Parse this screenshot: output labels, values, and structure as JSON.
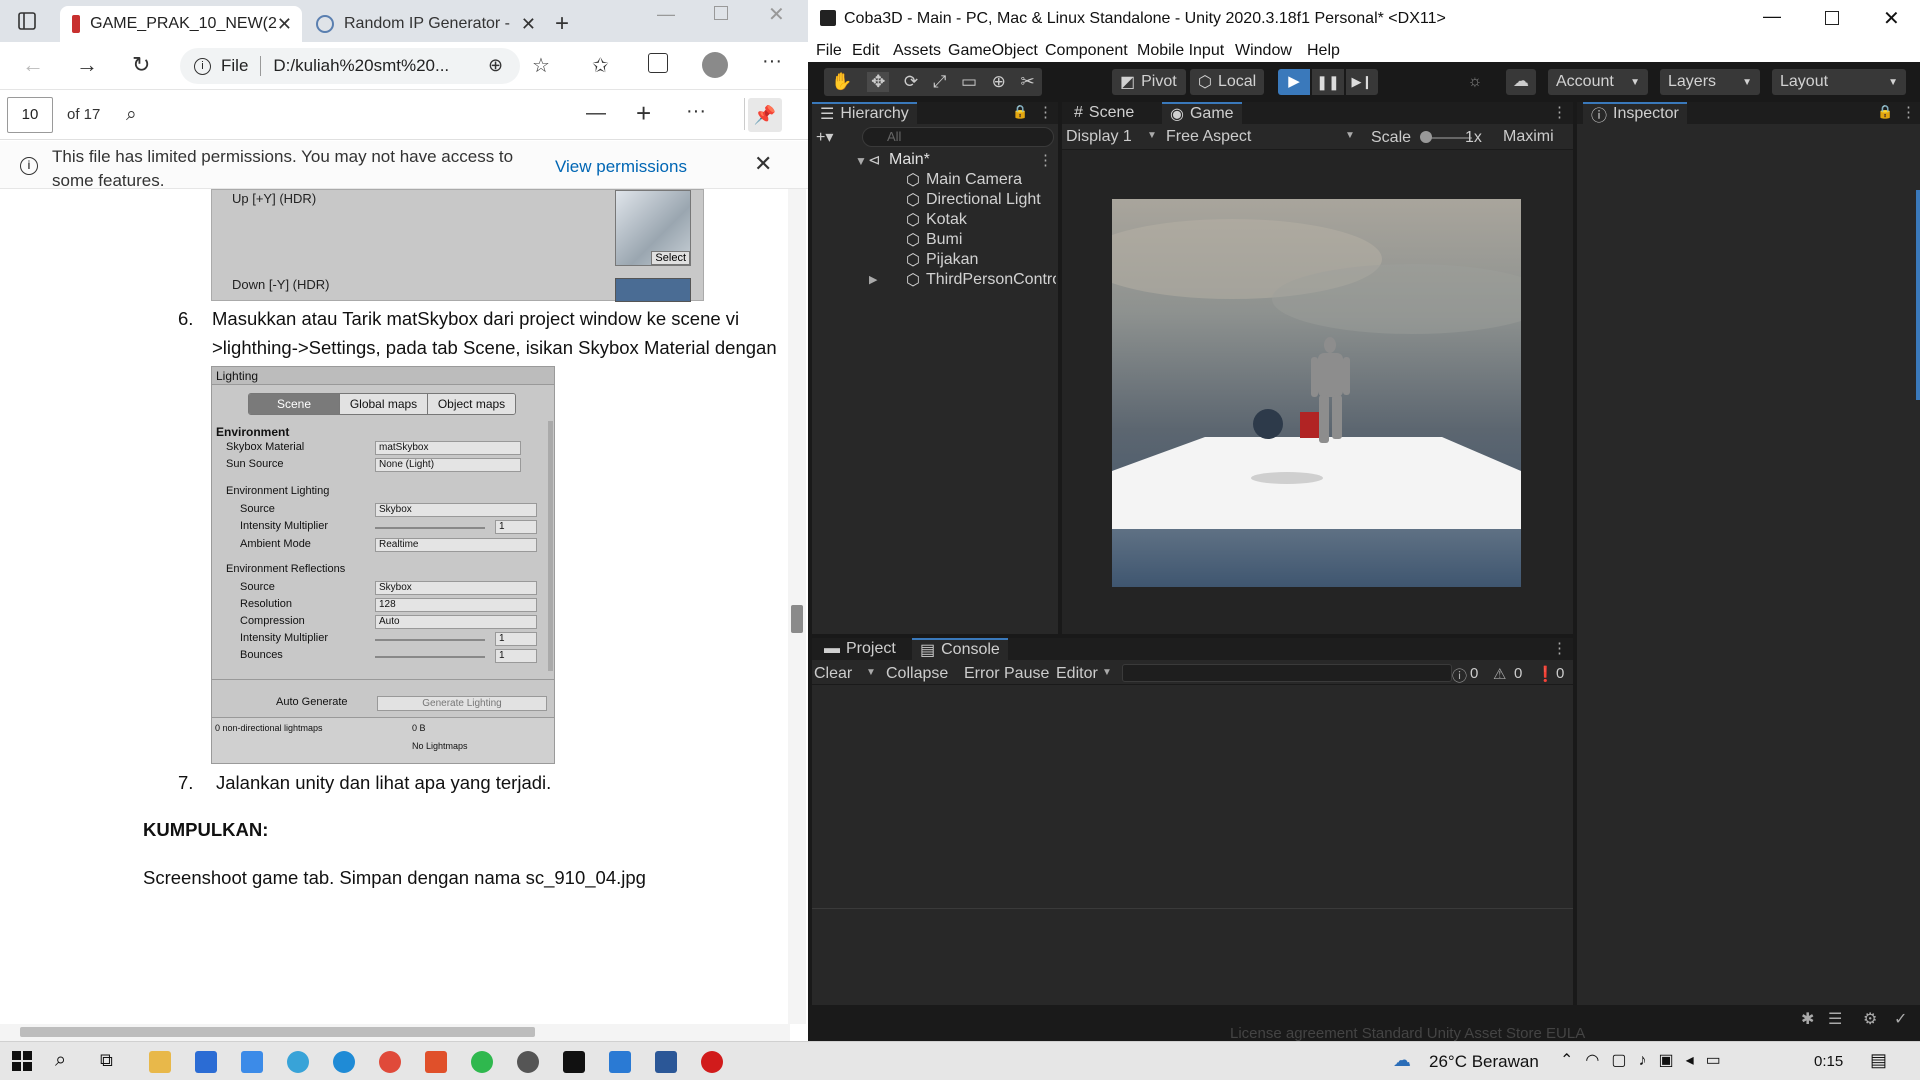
{
  "browser": {
    "tabs": [
      {
        "title": "GAME_PRAK_10_NEW(2",
        "icon": "pdf-icon"
      },
      {
        "title": "Random IP Generator -",
        "icon": "web-icon"
      }
    ],
    "url_label": "File",
    "url": "D:/kuliah%20smt%20...",
    "pdf": {
      "page_current": "10",
      "page_total": "of 17"
    },
    "notice": {
      "text": "This file has limited permissions. You may not have access to some features.",
      "link": "View permissions"
    }
  },
  "document": {
    "skybox_labels": [
      "Up [+Y]   (HDR)",
      "Down [-Y]   (HDR)"
    ],
    "select_label": "Select",
    "step6_num": "6.",
    "step6_line1": "Masukkan atau Tarik matSkybox dari project window ke scene vi",
    "step6_line2": ">lighthing->Settings, pada tab Scene, isikan Skybox Material dengan",
    "lighting": {
      "title": "Lighting",
      "tabs": [
        "Scene",
        "Global maps",
        "Object maps"
      ],
      "environment_header": "Environment",
      "rows": [
        {
          "label": "Skybox Material",
          "value": "matSkybox"
        },
        {
          "label": "Sun Source",
          "value": "None (Light)"
        }
      ],
      "env_lighting_header": "Environment Lighting",
      "env_lighting_rows": [
        {
          "label": "Source",
          "value": "Skybox"
        },
        {
          "label": "Intensity Multiplier",
          "value": "1"
        },
        {
          "label": "Ambient Mode",
          "value": "Realtime"
        }
      ],
      "env_reflections_header": "Environment Reflections",
      "env_reflection_rows": [
        {
          "label": "Source",
          "value": "Skybox"
        },
        {
          "label": "Resolution",
          "value": "128"
        },
        {
          "label": "Compression",
          "value": "Auto"
        },
        {
          "label": "Intensity Multiplier",
          "value": "1"
        },
        {
          "label": "Bounces",
          "value": "1"
        }
      ],
      "auto_generate": "Auto Generate",
      "generate_button": "Generate Lighting",
      "lightmaps_label": "0 non-directional lightmaps",
      "lightmaps_size": "0 B",
      "no_lightmaps": "No Lightmaps"
    },
    "step7_num": "7.",
    "step7": "Jalankan unity dan lihat apa yang terjadi.",
    "kumpulkan": "KUMPULKAN:",
    "screenshot_text": "Screenshoot game tab. Simpan dengan nama sc_910_04.jpg"
  },
  "unity": {
    "window_title": "Coba3D - Main - PC, Mac & Linux Standalone - Unity 2020.3.18f1 Personal* <DX11>",
    "menu": [
      "File",
      "Edit",
      "Assets",
      "GameObject",
      "Component",
      "Mobile Input",
      "Window",
      "Help"
    ],
    "toolbar": {
      "pivot": "Pivot",
      "local": "Local",
      "account": "Account",
      "layers": "Layers",
      "layout": "Layout"
    },
    "hierarchy": {
      "tab": "Hierarchy",
      "search_placeholder": "All",
      "scene": "Main*",
      "items": [
        "Main Camera",
        "Directional Light",
        "Kotak",
        "Bumi",
        "Pijakan",
        "ThirdPersonControlle"
      ]
    },
    "game": {
      "scene_tab": "Scene",
      "game_tab": "Game",
      "display": "Display 1",
      "aspect": "Free Aspect",
      "scale_label": "Scale",
      "scale_value": "1x",
      "maximize": "Maximi"
    },
    "inspector": {
      "tab": "Inspector"
    },
    "console": {
      "project_tab": "Project",
      "console_tab": "Console",
      "clear": "Clear",
      "collapse": "Collapse",
      "error_pause": "Error Pause",
      "editor": "Editor",
      "log_count": "0",
      "warn_count": "0",
      "error_count": "0"
    },
    "status_text": "License agreement   Standard Unity Asset Store EULA"
  },
  "taskbar": {
    "weather": "26°C  Berawan",
    "time": "0:15"
  },
  "colors": {
    "unity_dark": "#191919",
    "unity_panel": "#282828",
    "play_blue": "#3a79bb",
    "edge_link": "#0066b4"
  }
}
